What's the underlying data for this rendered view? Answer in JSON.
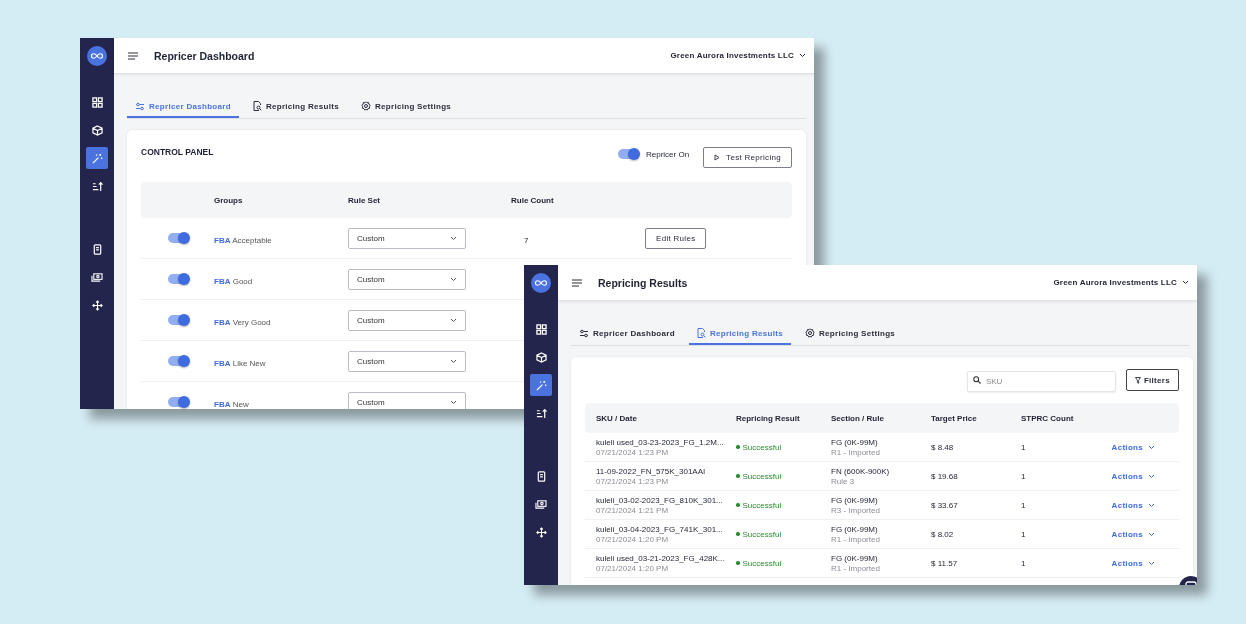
{
  "windows": [
    {
      "kind": "dashboard",
      "title": "Repricer Dashboard",
      "company": "Green Aurora Investments LLC",
      "sidebar": [
        {
          "kind": "grid",
          "selected": false
        },
        {
          "kind": "box",
          "selected": false
        },
        {
          "kind": "wand",
          "selected": true
        },
        {
          "kind": "sort",
          "selected": false
        },
        {
          "kind": "receipt",
          "selected": false
        },
        {
          "kind": "money",
          "selected": false
        },
        {
          "kind": "move",
          "selected": false
        }
      ],
      "tabs": [
        {
          "label": "Repricer Dashboard",
          "kind": "sliders",
          "selected": true
        },
        {
          "label": "Repricing Results",
          "kind": "report",
          "selected": false
        },
        {
          "label": "Repricing Settings",
          "kind": "gear",
          "selected": false
        }
      ],
      "panel": {
        "title": "CONTROL PANEL",
        "repricer_toggle": {
          "label": "Repricer On",
          "on": true
        },
        "test_button": "Test Repricing"
      },
      "table": {
        "columns": [
          "Groups",
          "Rule Set",
          "Rule Count"
        ],
        "rows": [
          {
            "on": true,
            "channel": "FBA",
            "condition": "Acceptable",
            "rule_set": "Custom",
            "rule_count": "7",
            "button": "Edit Rules"
          },
          {
            "on": true,
            "channel": "FBA",
            "condition": "Good",
            "rule_set": "Custom"
          },
          {
            "on": true,
            "channel": "FBA",
            "condition": "Very Good",
            "rule_set": "Custom"
          },
          {
            "on": true,
            "channel": "FBA",
            "condition": "Like New",
            "rule_set": "Custom"
          },
          {
            "on": true,
            "channel": "FBA",
            "condition": "New",
            "rule_set": "Custom"
          }
        ]
      }
    },
    {
      "kind": "results",
      "title": "Repricing Results",
      "company": "Green Aurora Investments LLC",
      "sidebar": [
        {
          "kind": "grid",
          "selected": false
        },
        {
          "kind": "box",
          "selected": false
        },
        {
          "kind": "wand",
          "selected": true
        },
        {
          "kind": "sort",
          "selected": false
        },
        {
          "kind": "receipt",
          "selected": false
        },
        {
          "kind": "money",
          "selected": false
        },
        {
          "kind": "move",
          "selected": false
        }
      ],
      "tabs": [
        {
          "label": "Repricer Dashboard",
          "kind": "sliders",
          "selected": false
        },
        {
          "label": "Repricing Results",
          "kind": "report",
          "selected": true
        },
        {
          "label": "Repricing Settings",
          "kind": "gear",
          "selected": false
        }
      ],
      "search": {
        "placeholder": "SKU"
      },
      "filters_button": "Filters",
      "table": {
        "columns": [
          "SKU / Date",
          "Repricing Result",
          "Section / Rule",
          "Target Price",
          "STPRC Count"
        ],
        "rows": [
          {
            "sku": "kuleli used_03-23-2023_FG_1.2M...",
            "date": "07/21/2024 1:23 PM",
            "result": "Successful",
            "section": "FG (0K-99M)",
            "rule": "R1 - Imported",
            "price": "$ 8.48",
            "count": "1",
            "action": "Actions"
          },
          {
            "sku": "11-09-2022_FN_575K_301AAI",
            "date": "07/21/2024 1:23 PM",
            "result": "Successful",
            "section": "FN (600K-900K)",
            "rule": "Rule 3",
            "price": "$ 19.68",
            "count": "1",
            "action": "Actions"
          },
          {
            "sku": "kuleli_03-02-2023_FG_810K_301...",
            "date": "07/21/2024 1:21 PM",
            "result": "Successful",
            "section": "FG (0K-99M)",
            "rule": "R3 - Imported",
            "price": "$ 33.67",
            "count": "1",
            "action": "Actions"
          },
          {
            "sku": "kuleli_03-04-2023_FG_741K_301...",
            "date": "07/21/2024 1:20 PM",
            "result": "Successful",
            "section": "FG (0K-99M)",
            "rule": "R1 - Imported",
            "price": "$ 8.02",
            "count": "1",
            "action": "Actions"
          },
          {
            "sku": "kuleli used_03-21-2023_FG_428K...",
            "date": "07/21/2024 1:20 PM",
            "result": "Successful",
            "section": "FG (0K-99M)",
            "rule": "R1 - Imported",
            "price": "$ 11.57",
            "count": "1",
            "action": "Actions"
          }
        ]
      }
    }
  ]
}
